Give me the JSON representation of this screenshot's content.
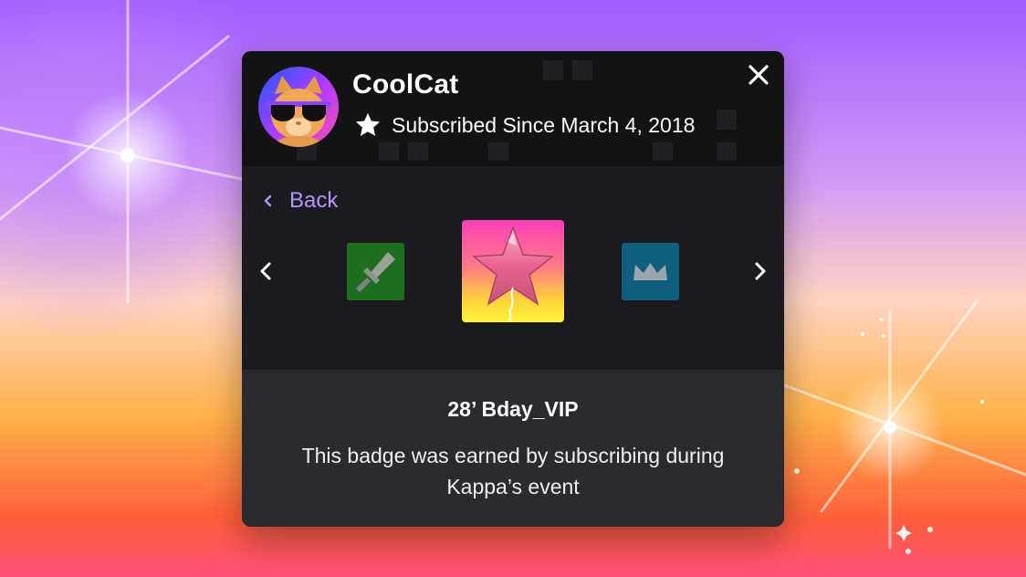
{
  "profile": {
    "username": "CoolCat",
    "subscription_text": "Subscribed Since March 4, 2018"
  },
  "navigation": {
    "back_label": "Back"
  },
  "badges": [
    {
      "icon": "sword-icon",
      "color": "#1f6e1f",
      "selected": false
    },
    {
      "icon": "star-balloon-icon",
      "color": "#ff3fb8",
      "selected": true
    },
    {
      "icon": "crown-icon",
      "color": "#0f5f7d",
      "selected": false
    }
  ],
  "selected_badge": {
    "name": "28’ Bday_VIP",
    "description": "This badge was earned by subscribing during Kappa’s event"
  },
  "colors": {
    "card_bg": "#1b1b1f",
    "header_bg": "#131316",
    "footer_bg": "#2a2a30",
    "accent": "#b893ff"
  }
}
